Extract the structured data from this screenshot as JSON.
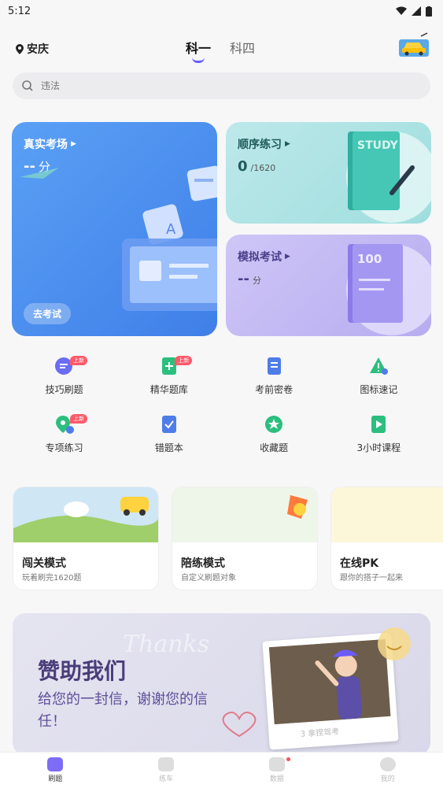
{
  "status_bar": {
    "time": "5:12"
  },
  "header": {
    "location": "安庆",
    "tabs": [
      "科一",
      "科四"
    ]
  },
  "search": {
    "placeholder": "违法"
  },
  "cards": {
    "exam": {
      "title": "真实考场",
      "score": "--",
      "unit": "分",
      "button": "去考试"
    },
    "sequence": {
      "title": "顺序练习",
      "progress": "0",
      "total": "/1620",
      "art_text": "STUDY"
    },
    "mock": {
      "title": "模拟考试",
      "score": "--",
      "unit": "分",
      "art_text": "100"
    }
  },
  "grid": {
    "new_badge": "上新",
    "items": [
      {
        "label": "技巧刷题",
        "icon": "chat-edit-icon",
        "color": "#6a6cf6",
        "new": true
      },
      {
        "label": "精华题库",
        "icon": "book-plus-icon",
        "color": "#2bbf7e",
        "new": true
      },
      {
        "label": "考前密卷",
        "icon": "document-icon",
        "color": "#4e7de8",
        "new": false
      },
      {
        "label": "图标速记",
        "icon": "warning-sign-icon",
        "color": "#2bbf7e",
        "new": false
      },
      {
        "label": "专项练习",
        "icon": "pin-hash-icon",
        "color": "#2bbf7e",
        "new": true
      },
      {
        "label": "错题本",
        "icon": "check-book-icon",
        "color": "#4e7de8",
        "new": false
      },
      {
        "label": "收藏题",
        "icon": "star-icon",
        "color": "#2bbf7e",
        "new": false
      },
      {
        "label": "3小时课程",
        "icon": "play-icon",
        "color": "#2bbf7e",
        "new": false
      }
    ]
  },
  "modes": [
    {
      "title": "闯关模式",
      "subtitle": "玩着刷完1620题"
    },
    {
      "title": "陪练模式",
      "subtitle": "自定义刷题对象"
    },
    {
      "title": "在线PK",
      "subtitle": "跟你的搭子一起来"
    }
  ],
  "banner": {
    "title": "赞助我们",
    "subtitle": "给您的一封信，谢谢您的信任！",
    "thanks": "Thanks",
    "caption": "3 拿捏驾考"
  },
  "bottom_nav": [
    {
      "label": "刷题",
      "active": true
    },
    {
      "label": "练车",
      "active": false
    },
    {
      "label": "数据",
      "active": false,
      "dot": true
    },
    {
      "label": "我的",
      "active": false
    }
  ],
  "colors": {
    "accent": "#6a5cff",
    "exam_blue": "#4a8cf0",
    "sequence_teal": "#a8e2e2",
    "mock_purple": "#c0b6f4"
  }
}
